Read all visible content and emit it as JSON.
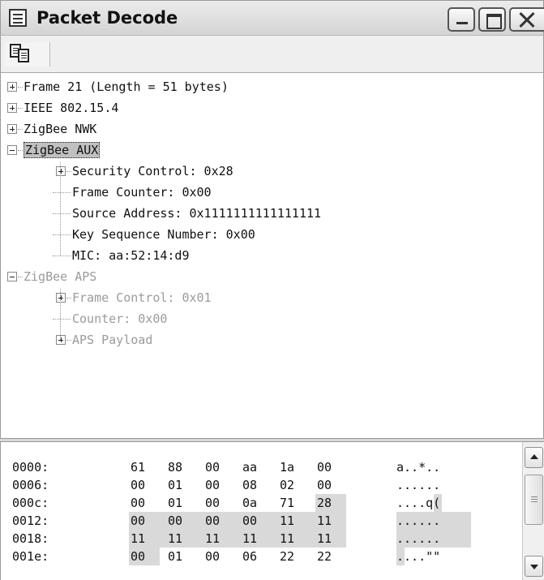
{
  "window": {
    "title": "Packet Decode",
    "icon": "document-icon"
  },
  "toolbar": {
    "copy_icon": "copy-icon"
  },
  "tree": {
    "nodes": [
      {
        "label": "Frame 21 (Length = 51 bytes)",
        "expander": "plus",
        "level": 0,
        "state": "normal"
      },
      {
        "label": "IEEE 802.15.4",
        "expander": "plus",
        "level": 0,
        "state": "normal"
      },
      {
        "label": "ZigBee NWK",
        "expander": "plus",
        "level": 0,
        "state": "normal"
      },
      {
        "label": "ZigBee AUX",
        "expander": "minus",
        "level": 0,
        "state": "selected"
      },
      {
        "label": "Security Control: 0x28",
        "expander": "plus",
        "level": 1,
        "state": "normal"
      },
      {
        "label": "Frame Counter: 0x00",
        "expander": "none",
        "level": 1,
        "state": "normal"
      },
      {
        "label": "Source Address: 0x1111111111111111",
        "expander": "none",
        "level": 1,
        "state": "normal"
      },
      {
        "label": "Key Sequence Number: 0x00",
        "expander": "none",
        "level": 1,
        "state": "normal"
      },
      {
        "label": "MIC: aa:52:14:d9",
        "expander": "none",
        "level": 1,
        "state": "normal"
      },
      {
        "label": "ZigBee APS",
        "expander": "minus",
        "level": 0,
        "state": "disabled"
      },
      {
        "label": "Frame Control: 0x01",
        "expander": "plus",
        "level": 1,
        "state": "disabled"
      },
      {
        "label": "Counter: 0x00",
        "expander": "none",
        "level": 1,
        "state": "disabled"
      },
      {
        "label": "APS Payload",
        "expander": "plus",
        "level": 1,
        "state": "disabled"
      }
    ]
  },
  "hex": {
    "rows": [
      {
        "offset": "0000:",
        "bytes": [
          "61",
          "88",
          "00",
          "aa",
          "1a",
          "00"
        ],
        "ascii": "a..*..",
        "highlight": [
          false,
          false,
          false,
          false,
          false,
          false
        ],
        "ascii_highlight": false
      },
      {
        "offset": "0006:",
        "bytes": [
          "00",
          "01",
          "00",
          "08",
          "02",
          "00"
        ],
        "ascii": "......",
        "highlight": [
          false,
          false,
          false,
          false,
          false,
          false
        ],
        "ascii_highlight": false
      },
      {
        "offset": "000c:",
        "bytes": [
          "00",
          "01",
          "00",
          "0a",
          "71",
          "28"
        ],
        "ascii": "....q(",
        "highlight": [
          false,
          false,
          false,
          false,
          false,
          true
        ],
        "ascii_highlight": false
      },
      {
        "offset": "0012:",
        "bytes": [
          "00",
          "00",
          "00",
          "00",
          "11",
          "11"
        ],
        "ascii": "......",
        "highlight": [
          true,
          true,
          true,
          true,
          true,
          true
        ],
        "ascii_highlight": true
      },
      {
        "offset": "0018:",
        "bytes": [
          "11",
          "11",
          "11",
          "11",
          "11",
          "11"
        ],
        "ascii": "......",
        "highlight": [
          true,
          true,
          true,
          true,
          true,
          true
        ],
        "ascii_highlight": true
      },
      {
        "offset": "001e:",
        "bytes": [
          "00",
          "01",
          "00",
          "06",
          "22",
          "22"
        ],
        "ascii": "....\"\"",
        "highlight": [
          true,
          false,
          false,
          false,
          false,
          false
        ],
        "ascii_highlight": false
      }
    ]
  },
  "colors": {
    "selection": "#c0c0c0",
    "hex_highlight": "#d9d9d9",
    "disabled_text": "#9b9b9b"
  }
}
